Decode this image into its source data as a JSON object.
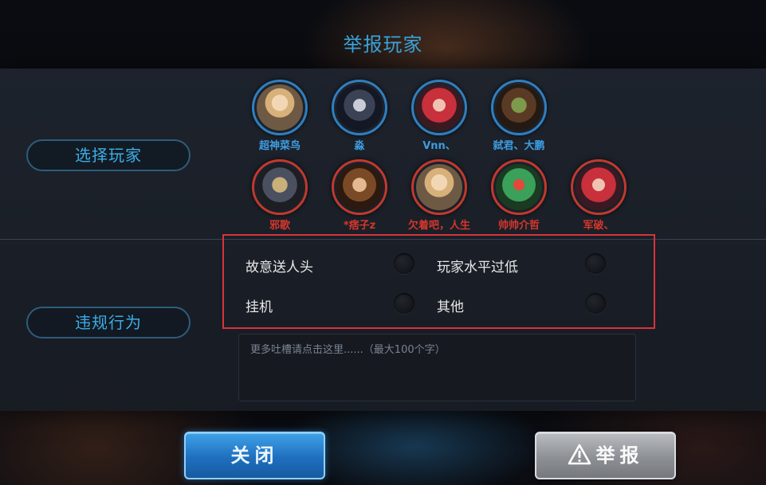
{
  "dialog": {
    "title": "举报玩家"
  },
  "sections": {
    "select_player": "选择玩家",
    "violation": "违规行为"
  },
  "players_ally": [
    {
      "name": "超神菜鸟",
      "color": "#3d9de0"
    },
    {
      "name": "淼",
      "color": "#3d9de0"
    },
    {
      "name": "Vnn、",
      "color": "#3d9de0"
    },
    {
      "name": "弑君、大鹏",
      "color": "#3d9de0"
    }
  ],
  "players_enemy": [
    {
      "name": "邪歌",
      "color": "#d6362c"
    },
    {
      "name": "*痞子z",
      "color": "#d6362c"
    },
    {
      "name": "欠着吧，人生",
      "color": "#d6362c"
    },
    {
      "name": "帅帅介哲",
      "color": "#d6362c"
    },
    {
      "name": "军破、",
      "color": "#d6362c"
    }
  ],
  "violations": [
    {
      "label": "故意送人头",
      "selected": false
    },
    {
      "label": "玩家水平过低",
      "selected": false
    },
    {
      "label": "挂机",
      "selected": false
    },
    {
      "label": "其他",
      "selected": false
    }
  ],
  "comment": {
    "placeholder": "更多吐槽请点击这里......（最大100个字）"
  },
  "buttons": {
    "close": "关闭",
    "report": "举报"
  },
  "icons": {
    "report": "warning-triangle-icon"
  },
  "colors": {
    "accent": "#39a6de",
    "ally": "#2f7fc0",
    "enemy": "#c1392d",
    "highlight_border": "#d7343a"
  }
}
